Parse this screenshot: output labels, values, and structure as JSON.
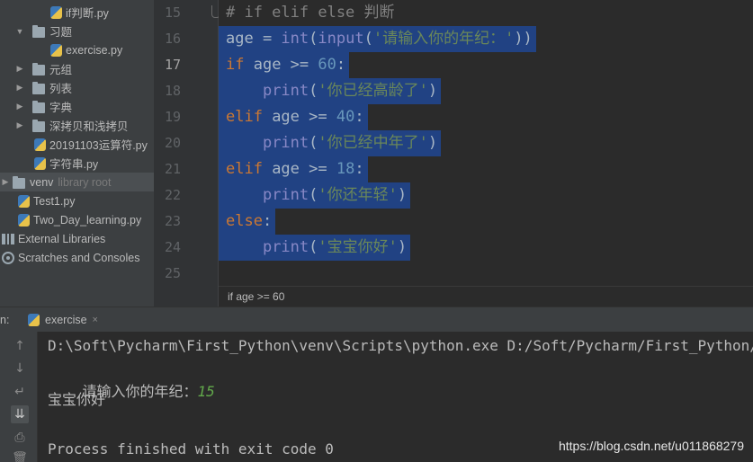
{
  "project_tree": {
    "items": [
      {
        "label": "if判断.py"
      },
      {
        "label": "习题"
      },
      {
        "label": "exercise.py"
      },
      {
        "label": "元组"
      },
      {
        "label": "列表"
      },
      {
        "label": "字典"
      },
      {
        "label": "深拷贝和浅拷贝"
      },
      {
        "label": "20191103运算符.py"
      },
      {
        "label": "字符串.py"
      },
      {
        "label": "venv",
        "hint": "library root"
      },
      {
        "label": "Test1.py"
      },
      {
        "label": "Two_Day_learning.py"
      },
      {
        "label": "External Libraries"
      },
      {
        "label": "Scratches and Consoles"
      }
    ]
  },
  "editor": {
    "line_numbers": [
      "15",
      "16",
      "17",
      "18",
      "19",
      "20",
      "21",
      "22",
      "23",
      "24",
      "25"
    ],
    "current_line": "17",
    "lines": [
      [
        {
          "t": "# if elif else 判断",
          "c": "cmt"
        }
      ],
      [
        {
          "t": "age = ",
          "c": ""
        },
        {
          "t": "int",
          "c": "bi"
        },
        {
          "t": "(",
          "c": ""
        },
        {
          "t": "input",
          "c": "bi"
        },
        {
          "t": "(",
          "c": ""
        },
        {
          "t": "'请输入你的年纪：'",
          "c": "str"
        },
        {
          "t": "))",
          "c": ""
        }
      ],
      [
        {
          "t": "if",
          "c": "kw"
        },
        {
          "t": " age >= ",
          "c": ""
        },
        {
          "t": "60",
          "c": "num"
        },
        {
          "t": ":",
          "c": ""
        }
      ],
      [
        {
          "t": "    ",
          "c": ""
        },
        {
          "t": "print",
          "c": "bi"
        },
        {
          "t": "(",
          "c": ""
        },
        {
          "t": "'你已经高龄了'",
          "c": "str"
        },
        {
          "t": ")",
          "c": ""
        }
      ],
      [
        {
          "t": "elif",
          "c": "kw"
        },
        {
          "t": " age >= ",
          "c": ""
        },
        {
          "t": "40",
          "c": "num"
        },
        {
          "t": ":",
          "c": ""
        }
      ],
      [
        {
          "t": "    ",
          "c": ""
        },
        {
          "t": "print",
          "c": "bi"
        },
        {
          "t": "(",
          "c": ""
        },
        {
          "t": "'你已经中年了'",
          "c": "str"
        },
        {
          "t": ")",
          "c": ""
        }
      ],
      [
        {
          "t": "elif",
          "c": "kw"
        },
        {
          "t": " age >= ",
          "c": ""
        },
        {
          "t": "18",
          "c": "num"
        },
        {
          "t": ":",
          "c": ""
        }
      ],
      [
        {
          "t": "    ",
          "c": ""
        },
        {
          "t": "print",
          "c": "bi"
        },
        {
          "t": "(",
          "c": ""
        },
        {
          "t": "'你还年轻'",
          "c": "str"
        },
        {
          "t": ")",
          "c": ""
        }
      ],
      [
        {
          "t": "else",
          "c": "kw"
        },
        {
          "t": ":",
          "c": ""
        }
      ],
      [
        {
          "t": "    ",
          "c": ""
        },
        {
          "t": "print",
          "c": "bi"
        },
        {
          "t": "(",
          "c": ""
        },
        {
          "t": "'宝宝你好'",
          "c": "str"
        },
        {
          "t": ")",
          "c": ""
        }
      ],
      []
    ],
    "breadcrumb": "if age >= 60"
  },
  "run_panel": {
    "label": "n:",
    "tab_label": "exercise",
    "close_glyph": "×",
    "console": {
      "command": "D:\\Soft\\Pycharm\\First_Python\\venv\\Scripts\\python.exe D:/Soft/Pycharm/First_Python/",
      "prompt": "请输入你的年纪：",
      "user_input": "15",
      "output": "宝宝你好",
      "exit": "Process finished with exit code 0"
    }
  },
  "watermark": "https://blog.csdn.net/u011868279",
  "colors": {
    "keyword": "#cc7832",
    "builtin": "#8888c6",
    "number": "#6897bb",
    "string": "#6a8759",
    "comment": "#808080",
    "selection": "#214283"
  },
  "icons": {
    "tool_up": "↑",
    "tool_down": "↓",
    "tool_wrap": "↵",
    "tool_scroll_end": "⇊",
    "tool_print": "⎙",
    "tool_delete": "🗑"
  }
}
